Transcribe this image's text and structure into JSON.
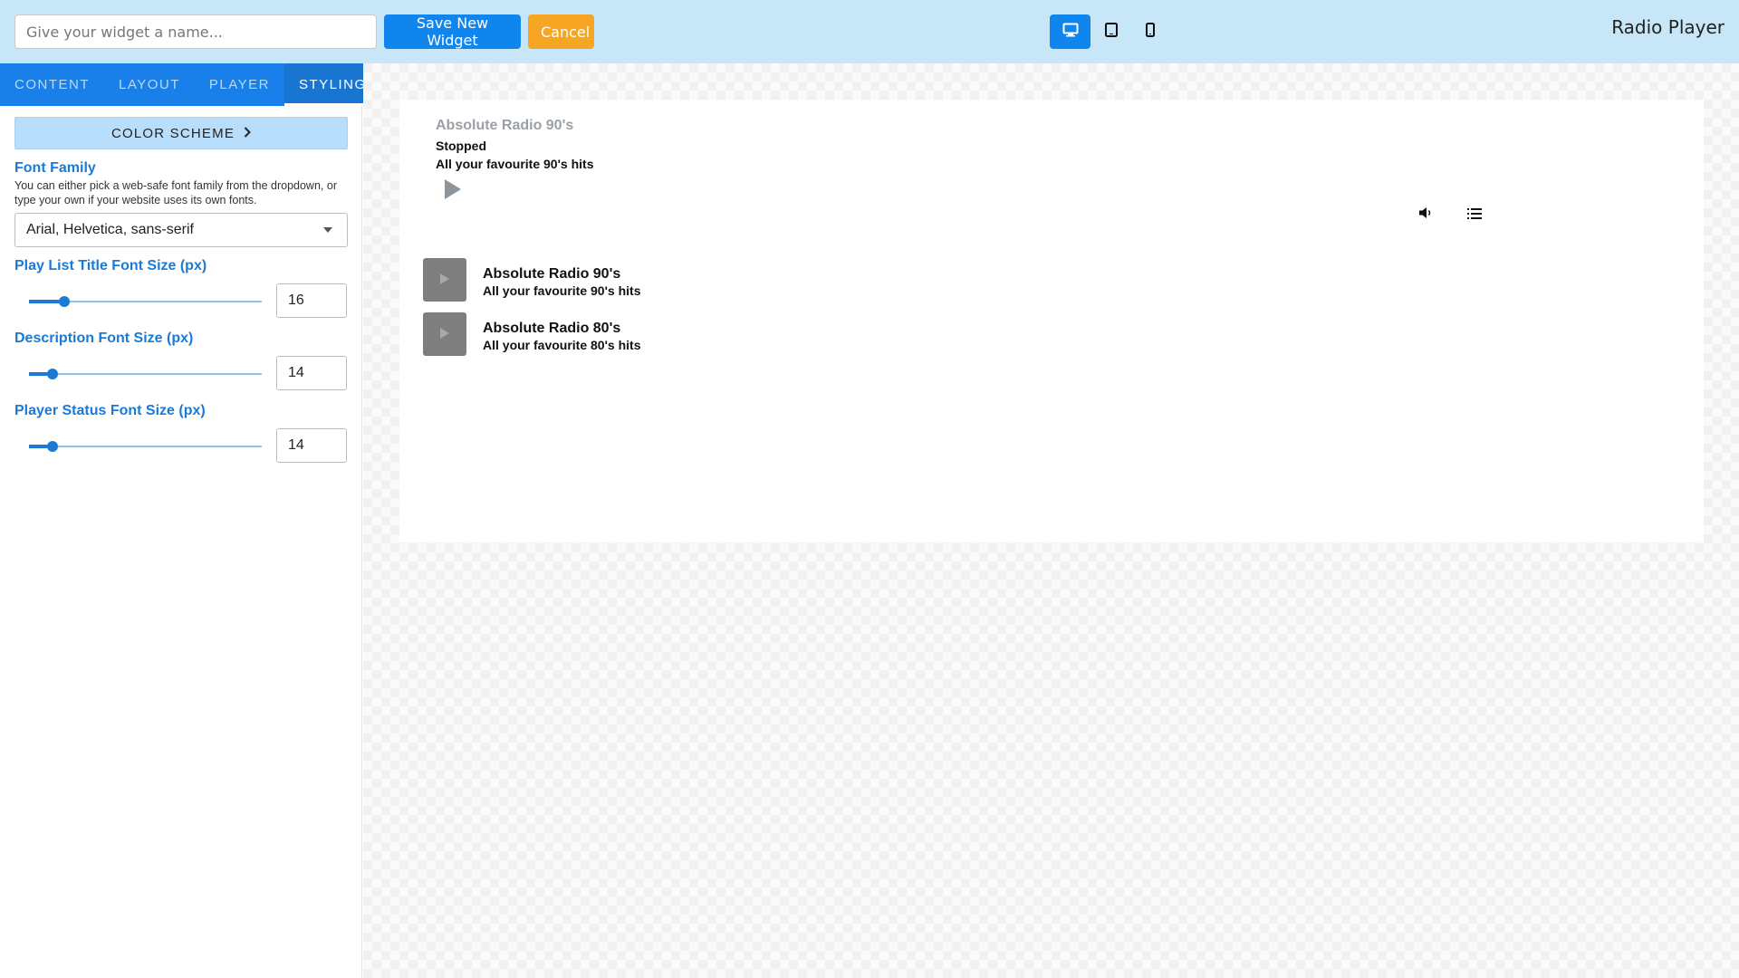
{
  "header": {
    "name_placeholder": "Give your widget a name...",
    "name_value": "",
    "save_label": "Save New Widget",
    "cancel_label": "Cancel",
    "devices": [
      {
        "icon": "desktop-icon",
        "active": true
      },
      {
        "icon": "tablet-icon",
        "active": false
      },
      {
        "icon": "mobile-icon",
        "active": false
      }
    ],
    "app_title": "Radio Player"
  },
  "colors": {
    "header_bg": "#c7e6f7",
    "primary": "#1185ee",
    "cancel": "#f7a623",
    "tab_bar": "#1880e8",
    "label_blue": "#1a7ad6"
  },
  "sidebar": {
    "tabs": [
      {
        "label": "CONTENT",
        "active": false
      },
      {
        "label": "LAYOUT",
        "active": false
      },
      {
        "label": "PLAYER",
        "active": false
      },
      {
        "label": "STYLING",
        "active": true
      }
    ],
    "color_scheme_label": "COLOR SCHEME",
    "font_family": {
      "label": "Font Family",
      "hint": "You can either pick a web-safe font family from the dropdown, or type your own if your website uses its own fonts.",
      "value": "Arial, Helvetica, sans-serif"
    },
    "sliders": [
      {
        "label": "Play List Title Font Size (px)",
        "value": "16",
        "fraction": 0.15
      },
      {
        "label": "Description Font Size (px)",
        "value": "14",
        "fraction": 0.1
      },
      {
        "label": "Player Status Font Size (px)",
        "value": "14",
        "fraction": 0.1
      }
    ]
  },
  "preview": {
    "now_playing": {
      "title": "Absolute Radio 90's",
      "status": "Stopped",
      "description": "All your favourite 90's hits"
    },
    "controls": {
      "play_icon": "play-icon",
      "volume_icon": "volume-icon",
      "playlist_icon": "list-icon"
    },
    "playlist": [
      {
        "title": "Absolute Radio 90's",
        "description": "All your favourite 90's hits"
      },
      {
        "title": "Absolute Radio 80's",
        "description": "All your favourite 80's hits"
      }
    ]
  }
}
